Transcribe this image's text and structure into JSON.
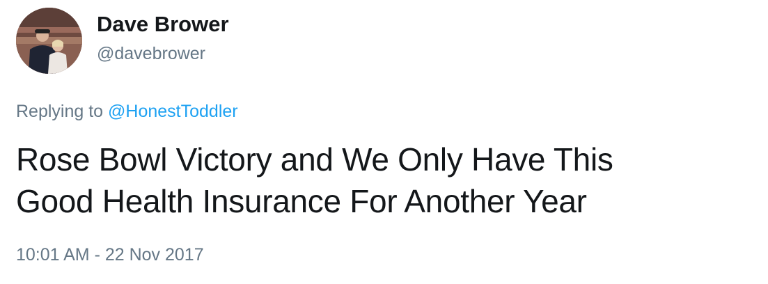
{
  "author": {
    "display_name": "Dave Brower",
    "handle": "@davebrower",
    "avatar_icon": "profile-photo-avatar"
  },
  "reply": {
    "prefix": "Replying to ",
    "mention": "@HonestToddler"
  },
  "tweet": {
    "text_line_1": "Rose Bowl Victory and We Only Have This",
    "text_line_2": "Good Health Insurance For Another Year"
  },
  "timestamp": "10:01 AM - 22 Nov 2017",
  "colors": {
    "text": "#14171a",
    "secondary": "#657786",
    "link": "#1da1f2"
  }
}
